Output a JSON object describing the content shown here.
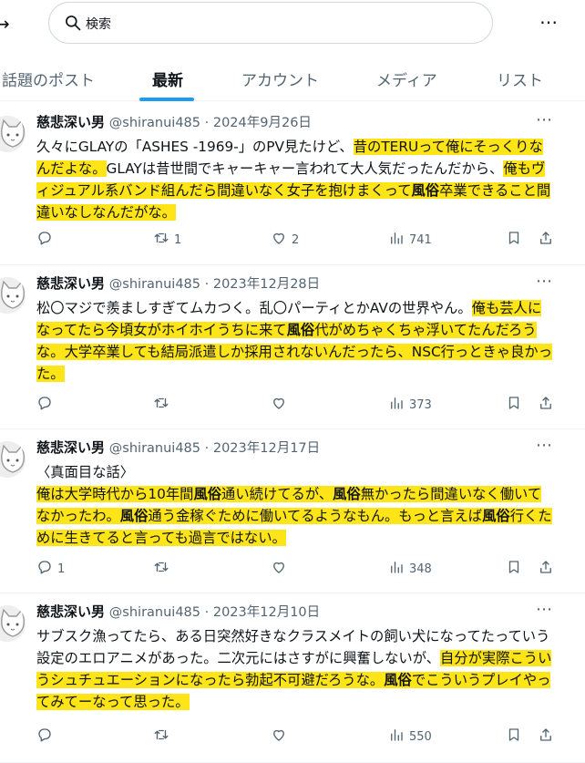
{
  "search": {
    "placeholder": "検索"
  },
  "tabs": [
    {
      "label": "話題のポスト"
    },
    {
      "label": "最新"
    },
    {
      "label": "アカウント"
    },
    {
      "label": "メディア"
    },
    {
      "label": "リスト"
    }
  ],
  "posts": [
    {
      "name": "慈悲深い男",
      "handle": "@shiranui485",
      "sep": " · ",
      "date": "2024年9月26日",
      "segments": [
        {
          "text": "久々にGLAYの「ASHES -1969-」のPV見たけど、",
          "hl": false,
          "bold": false
        },
        {
          "text": "昔のTERUって俺にそっくりなんだよな。",
          "hl": true,
          "bold": false
        },
        {
          "text": "GLAYは昔世間でキャーキャー言われて大人気だったんだから、",
          "hl": false,
          "bold": false
        },
        {
          "text": "俺もヴィジュアル系バンド組んだら間違いなく女子を抱けまくって",
          "hl": true,
          "bold": false
        },
        {
          "text": "風俗",
          "hl": true,
          "bold": true
        },
        {
          "text": "卒業できること間違いなしなんだがな。",
          "hl": true,
          "bold": false
        }
      ],
      "replies": "",
      "reposts": "1",
      "likes": "2",
      "views": "741"
    },
    {
      "name": "慈悲深い男",
      "handle": "@shiranui485",
      "sep": " · ",
      "date": "2023年12月28日",
      "segments": [
        {
          "text": "松〇マジで羨ましすぎてムカつく。乱〇パーティとかAVの世界やん。",
          "hl": false,
          "bold": false
        },
        {
          "text": "俺も芸人になってたら今頃女がホイホイうちに来て",
          "hl": true,
          "bold": false
        },
        {
          "text": "風俗",
          "hl": true,
          "bold": true
        },
        {
          "text": "代がめちゃくちゃ浮いてたんだろうな。大学卒業しても結局派遣しか採用されないんだったら、NSC行っときゃ良かった。",
          "hl": true,
          "bold": false
        }
      ],
      "replies": "",
      "reposts": "",
      "likes": "",
      "views": "373"
    },
    {
      "name": "慈悲深い男",
      "handle": "@shiranui485",
      "sep": " · ",
      "date": "2023年12月17日",
      "segments": [
        {
          "text": "〈真面目な話〉\n",
          "hl": false,
          "bold": false
        },
        {
          "text": "俺は大学時代から10年間",
          "hl": true,
          "bold": false
        },
        {
          "text": "風俗",
          "hl": true,
          "bold": true
        },
        {
          "text": "通い続けてるが、",
          "hl": true,
          "bold": false
        },
        {
          "text": "風俗",
          "hl": true,
          "bold": true
        },
        {
          "text": "無かったら間違いなく働いてなかったわ。",
          "hl": true,
          "bold": false
        },
        {
          "text": "風俗",
          "hl": true,
          "bold": true
        },
        {
          "text": "通う金稼ぐために働いてるようなもん。もっと言えば",
          "hl": true,
          "bold": false
        },
        {
          "text": "風俗",
          "hl": true,
          "bold": true
        },
        {
          "text": "行くために生きてると言っても過言ではない。",
          "hl": true,
          "bold": false
        }
      ],
      "replies": "1",
      "reposts": "",
      "likes": "",
      "views": "348"
    },
    {
      "name": "慈悲深い男",
      "handle": "@shiranui485",
      "sep": " · ",
      "date": "2023年12月10日",
      "segments": [
        {
          "text": "サブスク漁ってたら、ある日突然好きなクラスメイトの飼い犬になってたっていう設定のエロアニメがあった。二次元にはさすがに興奮しないが、",
          "hl": false,
          "bold": false
        },
        {
          "text": "自分が実際こういうシュチュエーションになったら勃起不可避だろうな。",
          "hl": true,
          "bold": false
        },
        {
          "text": "風俗",
          "hl": true,
          "bold": true
        },
        {
          "text": "でこういうプレイやってみてーなって思った。",
          "hl": true,
          "bold": false
        }
      ],
      "replies": "",
      "reposts": "",
      "likes": "",
      "views": "550"
    }
  ]
}
